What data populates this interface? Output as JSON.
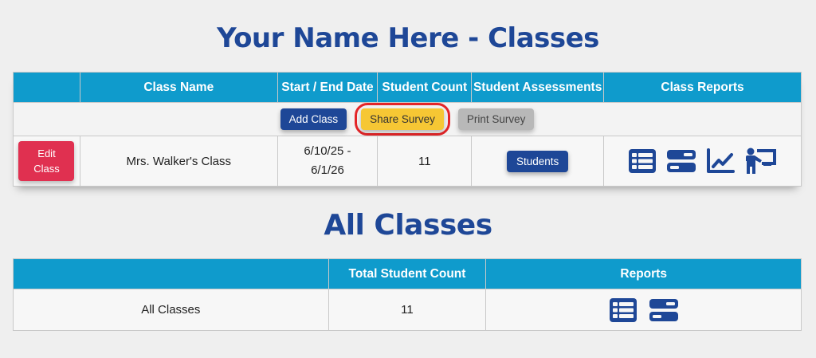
{
  "header": {
    "title": "Your Name Here  - Classes"
  },
  "classes_table": {
    "columns": [
      "",
      "Class Name",
      "Start / End Date",
      "Student Count",
      "Student Assessments",
      "Class Reports"
    ],
    "actions": {
      "add_class": "Add Class",
      "share_survey": "Share Survey",
      "print_survey": "Print Survey"
    },
    "rows": [
      {
        "edit_label": "Edit Class",
        "class_name": "Mrs. Walker's Class",
        "start_date": "6/10/25 -",
        "end_date": "6/1/26",
        "student_count": "11",
        "assessments_button": "Students",
        "report_icons": [
          "table-list-icon",
          "bars-icon",
          "line-chart-icon",
          "teacher-board-icon"
        ]
      }
    ]
  },
  "all_classes": {
    "title": "All Classes",
    "columns": [
      "",
      "Total Student Count",
      "Reports"
    ],
    "rows": [
      {
        "label": "All Classes",
        "total_student_count": "11",
        "report_icons": [
          "table-list-icon",
          "bars-icon"
        ]
      }
    ]
  },
  "colors": {
    "header_bg": "#0f9bcc",
    "title_blue": "#1e4797",
    "edit_red": "#e03050",
    "share_yellow": "#f6c734",
    "print_gray": "#b8b8b8",
    "highlight_red": "#e42528"
  }
}
